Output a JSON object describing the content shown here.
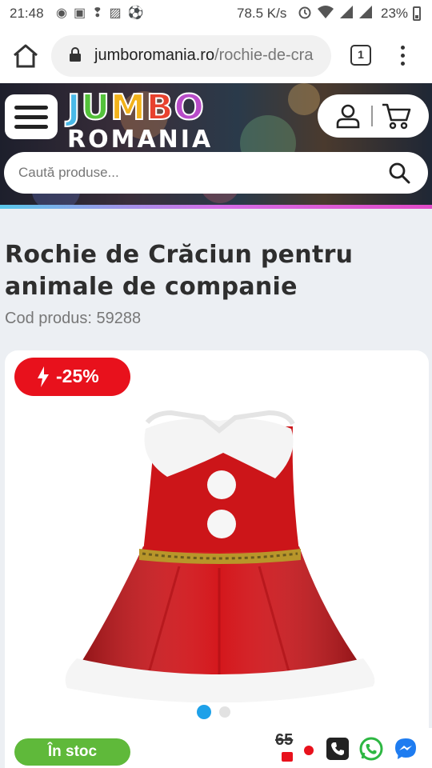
{
  "status": {
    "time": "21:48",
    "speed": "78.5 K/s",
    "battery": "23%"
  },
  "browser": {
    "url_domain": "jumboromania.ro",
    "url_path": "/rochie-de-cra",
    "tab_count": "1"
  },
  "header": {
    "logo_top": "JUMBO",
    "logo_bottom": "ROMANIA",
    "search_placeholder": "Caută produse..."
  },
  "product": {
    "title": "Rochie de Crăciun pentru animale de companie",
    "code": "Cod produs: 59288",
    "discount": "-25%",
    "stock": "În stoc",
    "old_price": "65",
    "gallery_images": 2,
    "gallery_active": 1
  },
  "colors": {
    "discount": "#e8111c",
    "stock": "#5fb93a",
    "gallery_active": "#1ea1e9"
  },
  "icons": [
    "home-icon",
    "lock-icon",
    "tabs-icon",
    "more-icon",
    "hamburger-icon",
    "user-icon",
    "cart-icon",
    "search-icon",
    "bolt-icon",
    "phone-icon",
    "whatsapp-icon",
    "messenger-icon"
  ]
}
